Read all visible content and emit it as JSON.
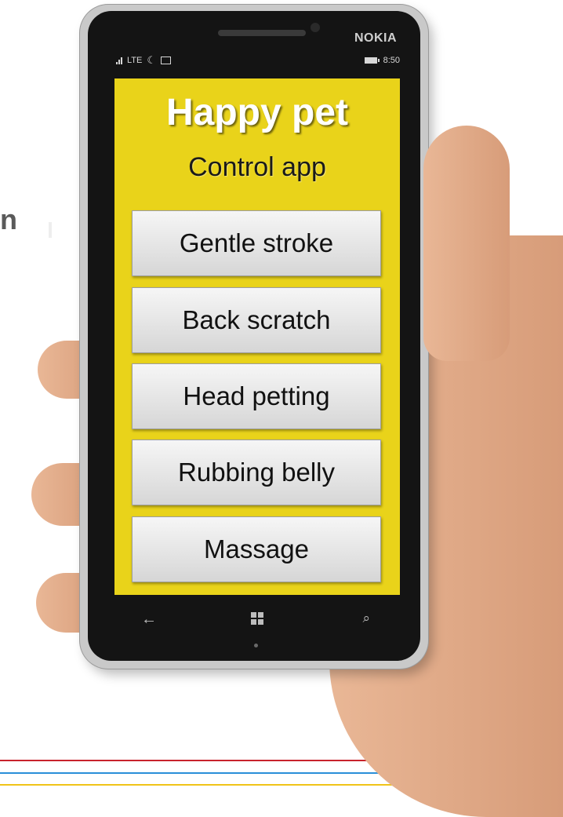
{
  "background": {
    "fragment_letter": "n",
    "stripe_colors": [
      "#c8232c",
      "#2a8fd8",
      "#f0c419"
    ]
  },
  "phone": {
    "brand": "NOKIA",
    "status": {
      "network": "LTE",
      "time": "8:50"
    },
    "icons": {
      "back": "back-arrow-icon",
      "start": "windows-logo-icon",
      "search": "search-icon"
    }
  },
  "app": {
    "title": "Happy pet",
    "subtitle": "Control app",
    "background_color": "#e9d31a",
    "buttons": [
      {
        "label": "Gentle stroke"
      },
      {
        "label": "Back scratch"
      },
      {
        "label": "Head petting"
      },
      {
        "label": "Rubbing belly"
      },
      {
        "label": "Massage"
      }
    ]
  }
}
